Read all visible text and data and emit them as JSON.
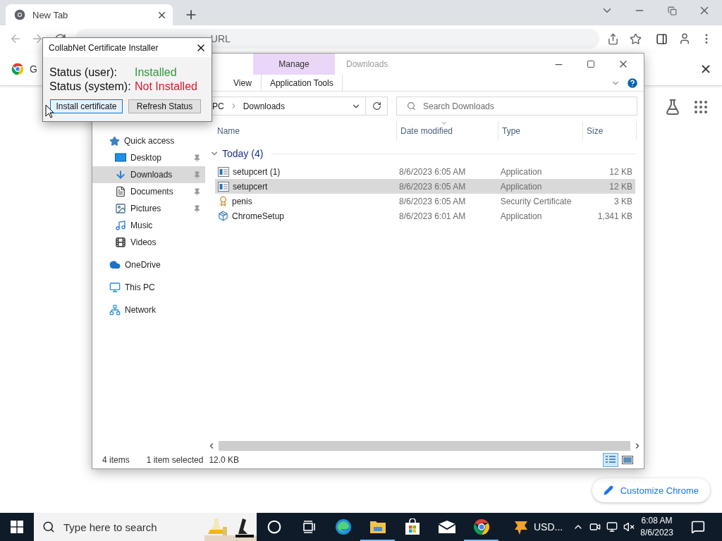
{
  "browser": {
    "tabs": [
      {
        "title": "New Tab",
        "selected": true
      }
    ],
    "omnibox": {
      "placeholder": "URL"
    },
    "infobar": {
      "text": "G"
    },
    "customize_button": "Customize Chrome"
  },
  "explorer": {
    "context_group": "Manage",
    "title": "Downloads",
    "ribbon_tabs": [
      {
        "label": "View",
        "kind": "plain",
        "selected": false
      },
      {
        "label": "Application Tools",
        "kind": "context",
        "selected": false
      }
    ],
    "breadcrumb": [
      "PC",
      "Downloads"
    ],
    "search": {
      "placeholder": "Search Downloads"
    },
    "nav": [
      {
        "label": "Quick access",
        "kind": "star",
        "selected": false,
        "children": [
          {
            "label": "Desktop",
            "kind": "desktop",
            "pinned": true,
            "selected": false
          },
          {
            "label": "Downloads",
            "kind": "downloads",
            "pinned": true,
            "selected": true
          },
          {
            "label": "Documents",
            "kind": "documents",
            "pinned": true,
            "selected": false
          },
          {
            "label": "Pictures",
            "kind": "pictures",
            "pinned": true,
            "selected": false
          },
          {
            "label": "Music",
            "kind": "music",
            "pinned": false,
            "selected": false
          },
          {
            "label": "Videos",
            "kind": "videos",
            "pinned": false,
            "selected": false
          }
        ]
      },
      {
        "label": "OneDrive",
        "kind": "cloud",
        "selected": false
      },
      {
        "label": "This PC",
        "kind": "pc",
        "selected": false
      },
      {
        "label": "Network",
        "kind": "network",
        "selected": false
      }
    ],
    "columns": [
      {
        "label": "Name",
        "sorted": false
      },
      {
        "label": "Date modified",
        "sorted": true
      },
      {
        "label": "Type",
        "sorted": false
      },
      {
        "label": "Size",
        "sorted": false
      }
    ],
    "groups": [
      {
        "label": "Today (4)",
        "expanded": true,
        "rows": [
          {
            "name": "setupcert (1)",
            "date": "8/6/2023 6:05 AM",
            "type": "Application",
            "size": "12 KB",
            "kind": "app",
            "selected": false
          },
          {
            "name": "setupcert",
            "date": "8/6/2023 6:05 AM",
            "type": "Application",
            "size": "12 KB",
            "kind": "app",
            "selected": true
          },
          {
            "name": "penis",
            "date": "8/6/2023 6:05 AM",
            "type": "Security Certificate",
            "size": "3 KB",
            "kind": "cert",
            "selected": false
          },
          {
            "name": "ChromeSetup",
            "date": "8/6/2023 6:01 AM",
            "type": "Application",
            "size": "1,341 KB",
            "kind": "installer",
            "selected": false
          }
        ]
      }
    ],
    "status": {
      "count": "4 items",
      "selection": "1 item selected",
      "size": "12.0 KB"
    },
    "views": [
      {
        "kind": "details",
        "selected": true
      },
      {
        "kind": "thumbnails",
        "selected": false
      }
    ]
  },
  "dialog": {
    "title": "CollabNet Certificate Installer",
    "statuses": [
      {
        "label": "Status (user):",
        "value": "Installed",
        "installed": true
      },
      {
        "label": "Status (system):",
        "value": "Not Installed",
        "installed": false
      }
    ],
    "buttons": [
      {
        "label": "Install certificate",
        "focused": true
      },
      {
        "label": "Refresh Status",
        "focused": false
      }
    ]
  },
  "taskbar": {
    "search_placeholder": "Type here to search",
    "apps": [
      {
        "kind": "cortana",
        "active": false
      },
      {
        "kind": "taskview",
        "active": false
      },
      {
        "kind": "edge",
        "active": false
      },
      {
        "kind": "explorer",
        "active": true
      },
      {
        "kind": "store",
        "active": false
      },
      {
        "kind": "mail",
        "active": false
      },
      {
        "kind": "chrome",
        "active": true
      }
    ],
    "tray_app": {
      "label": "USD..."
    },
    "clock": {
      "time": "6:08 AM",
      "date": "8/6/2023"
    }
  }
}
